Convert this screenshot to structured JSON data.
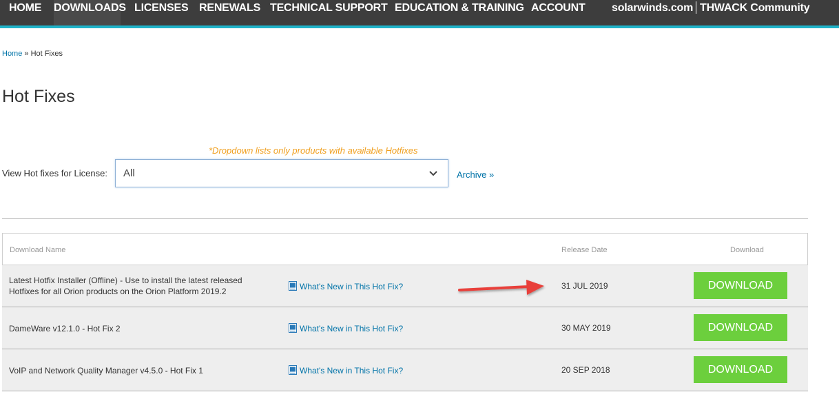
{
  "nav": {
    "items": [
      "HOME",
      "DOWNLOADS",
      "LICENSES",
      "RENEWALS",
      "TECHNICAL SUPPORT",
      "EDUCATION & TRAINING",
      "ACCOUNT"
    ],
    "active": "DOWNLOADS",
    "right_links": [
      "solarwinds.com",
      "THWACK Community"
    ]
  },
  "breadcrumb": {
    "home": "Home",
    "separator": "»",
    "current": "Hot Fixes"
  },
  "page": {
    "title": "Hot Fixes"
  },
  "filter": {
    "note": "*Dropdown lists only products with available Hotfixes",
    "label": "View Hot fixes for License:",
    "selected": "All",
    "archive_link": "Archive »"
  },
  "table": {
    "headers": {
      "name": "Download Name",
      "date": "Release Date",
      "download": "Download"
    },
    "rows": [
      {
        "name": "Latest Hotfix Installer (Offline) - Use to install the latest released Hotfixes for all Orion products on the Orion Platform 2019.2",
        "whats_new": "What's New in This Hot Fix?",
        "date": "31 JUL 2019",
        "button": "DOWNLOAD"
      },
      {
        "name": "DameWare v12.1.0 - Hot Fix 2",
        "whats_new": "What's New in This Hot Fix?",
        "date": "30 MAY 2019",
        "button": "DOWNLOAD"
      },
      {
        "name": "VoIP and Network Quality Manager v4.5.0 - Hot Fix 1",
        "whats_new": "What's New in This Hot Fix?",
        "date": "20 SEP 2018",
        "button": "DOWNLOAD"
      }
    ]
  },
  "colors": {
    "nav_bg": "#3d3d3d",
    "accent": "#1fb3c9",
    "link": "#0073a8",
    "note": "#f0a020",
    "download_button": "#6ccf3d",
    "arrow": "#e8413b"
  }
}
